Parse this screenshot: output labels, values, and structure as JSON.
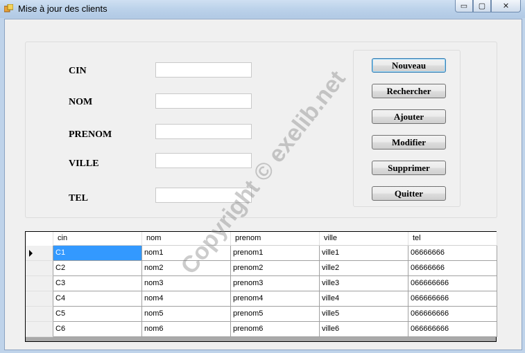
{
  "window": {
    "title": "Mise à jour des clients",
    "min_glyph": "▭",
    "max_glyph": "▢",
    "close_glyph": "✕"
  },
  "form": {
    "labels": {
      "cin": "CIN",
      "nom": "NOM",
      "prenom": "PRENOM",
      "ville": "VILLE",
      "tel": "TEL"
    },
    "values": {
      "cin": "",
      "nom": "",
      "prenom": "",
      "ville": "",
      "tel": ""
    }
  },
  "buttons": {
    "nouveau": "Nouveau",
    "rechercher": "Rechercher",
    "ajouter": "Ajouter",
    "modifier": "Modifier",
    "supprimer": "Supprimer",
    "quitter": "Quitter"
  },
  "grid": {
    "columns": [
      "cin",
      "nom",
      "prenom",
      "ville",
      "tel"
    ],
    "rows": [
      [
        "C1",
        "nom1",
        "prenom1",
        "ville1",
        "06666666"
      ],
      [
        "C2",
        "nom2",
        "prenom2",
        "ville2",
        "06666666"
      ],
      [
        "C3",
        "nom3",
        "prenom3",
        "ville3",
        "066666666"
      ],
      [
        "C4",
        "nom4",
        "prenom4",
        "ville4",
        "066666666"
      ],
      [
        "C5",
        "nom5",
        "prenom5",
        "ville5",
        "066666666"
      ],
      [
        "C6",
        "nom6",
        "prenom6",
        "ville6",
        "066666666"
      ]
    ],
    "selected_row": 0
  },
  "watermark": "Copyright © exelib.net",
  "colors": {
    "selection": "#3399ff",
    "titlebar": "#bcd2ea"
  }
}
